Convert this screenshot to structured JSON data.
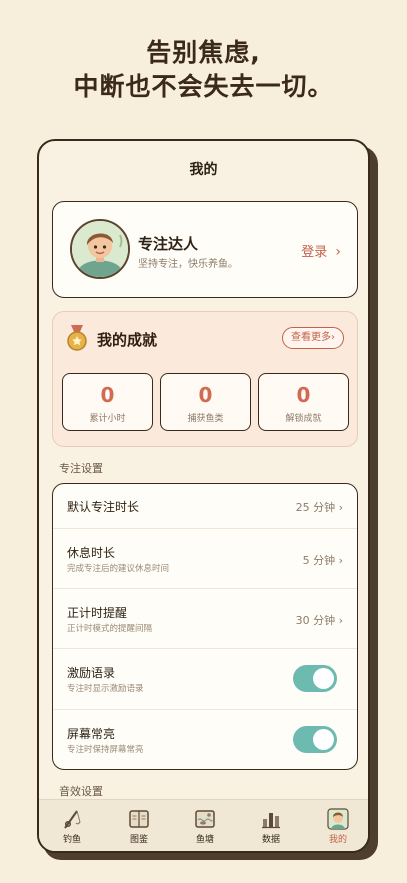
{
  "headline": {
    "line1": "告别焦虑,",
    "line2": "中断也不会失去一切。"
  },
  "screen": {
    "title": "我的"
  },
  "profile": {
    "name": "专注达人",
    "subtitle": "坚持专注，快乐养鱼。",
    "login_label": "登录",
    "login_chevron": "›"
  },
  "achievements": {
    "title": "我的成就",
    "more_label": "查看更多›",
    "stats": [
      {
        "value": "0",
        "label": "累计小时"
      },
      {
        "value": "0",
        "label": "捕获鱼类"
      },
      {
        "value": "0",
        "label": "解锁成就"
      }
    ]
  },
  "focus_settings": {
    "section_label": "专注设置",
    "rows": [
      {
        "title": "默认专注时长",
        "subtitle": "",
        "value": "25 分钟 ›"
      },
      {
        "title": "休息时长",
        "subtitle": "完成专注后的建议休息时间",
        "value": "5 分钟 ›"
      },
      {
        "title": "正计时提醒",
        "subtitle": "正计时模式的提醒间隔",
        "value": "30 分钟 ›"
      },
      {
        "title": "激励语录",
        "subtitle": "专注时显示激励语录",
        "toggle_on": true
      },
      {
        "title": "屏幕常亮",
        "subtitle": "专注时保持屏幕常亮",
        "toggle_on": true
      }
    ]
  },
  "sound_settings": {
    "section_label": "音效设置"
  },
  "tabbar": {
    "items": [
      {
        "label": "钓鱼",
        "icon": "fishing-rod-icon",
        "active": false
      },
      {
        "label": "图鉴",
        "icon": "book-icon",
        "active": false
      },
      {
        "label": "鱼塘",
        "icon": "pond-icon",
        "active": false
      },
      {
        "label": "数据",
        "icon": "bar-chart-icon",
        "active": false
      },
      {
        "label": "我的",
        "icon": "avatar-icon",
        "active": true
      }
    ]
  },
  "colors": {
    "background": "#f7eedb",
    "accent": "#c1624a",
    "toggle": "#6cbab0",
    "ink": "#3a2a1a"
  }
}
